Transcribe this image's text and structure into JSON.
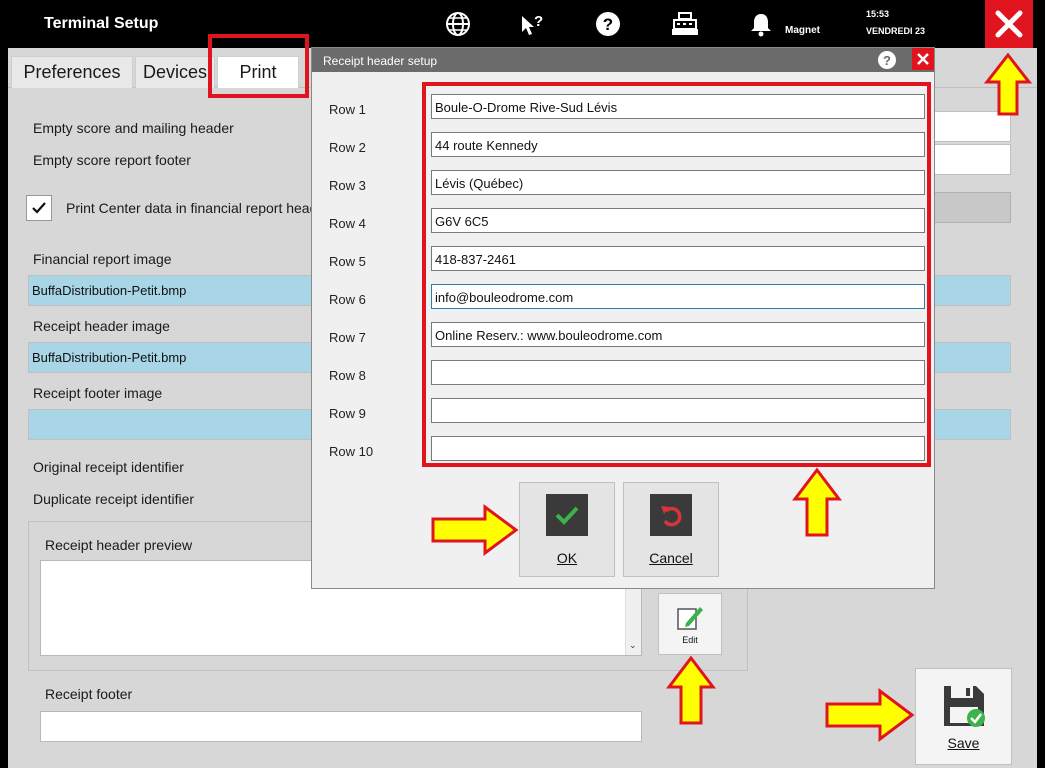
{
  "topbar": {
    "title": "Terminal Setup",
    "user": "Magnet",
    "time": "15:53",
    "date": "VENDREDI 23",
    "icons": [
      "globe-icon",
      "pointer-help-icon",
      "help-icon",
      "cash-register-icon",
      "bell-icon",
      "close-icon"
    ]
  },
  "tabs": [
    {
      "label": "Preferences"
    },
    {
      "label": "Devices"
    },
    {
      "label": "Print"
    }
  ],
  "print": {
    "empty_score_header": "Empty score and mailing header",
    "empty_score_footer": "Empty score report footer",
    "print_center_checkbox": "Print Center data in financial report head",
    "financial_image_label": "Financial report image",
    "financial_image_value": "BuffaDistribution-Petit.bmp",
    "receipt_header_image_label": "Receipt header image",
    "receipt_header_image_value": "BuffaDistribution-Petit.bmp",
    "receipt_footer_image_label": "Receipt footer image",
    "original_identifier": "Original receipt identifier",
    "duplicate_identifier": "Duplicate receipt identifier",
    "header_preview_label": "Receipt header preview",
    "edit_label": "Edit",
    "footer_label": "Receipt footer",
    "save_label": "Save"
  },
  "dialog": {
    "title": "Receipt header setup",
    "help": "?",
    "rows": [
      {
        "label": "Row 1",
        "value": "Boule-O-Drome Rive-Sud Lévis"
      },
      {
        "label": "Row 2",
        "value": "44 route Kennedy"
      },
      {
        "label": "Row 3",
        "value": "Lévis (Québec)"
      },
      {
        "label": "Row 4",
        "value": "G6V 6C5"
      },
      {
        "label": "Row 5",
        "value": "418-837-2461"
      },
      {
        "label": "Row 6",
        "value": "info@bouleodrome.com"
      },
      {
        "label": "Row 7",
        "value": "Online Reserv.: www.bouleodrome.com"
      },
      {
        "label": "Row 8",
        "value": ""
      },
      {
        "label": "Row 9",
        "value": ""
      },
      {
        "label": "Row 10",
        "value": ""
      }
    ],
    "ok_label": "OK",
    "cancel_label": "Cancel"
  },
  "colors": {
    "accent_red": "#e0141e",
    "annotation_yellow": "#ffff00",
    "ok_green": "#3cb34a",
    "cancel_red": "#d9343a",
    "field_blue": "#a8d6e6"
  }
}
